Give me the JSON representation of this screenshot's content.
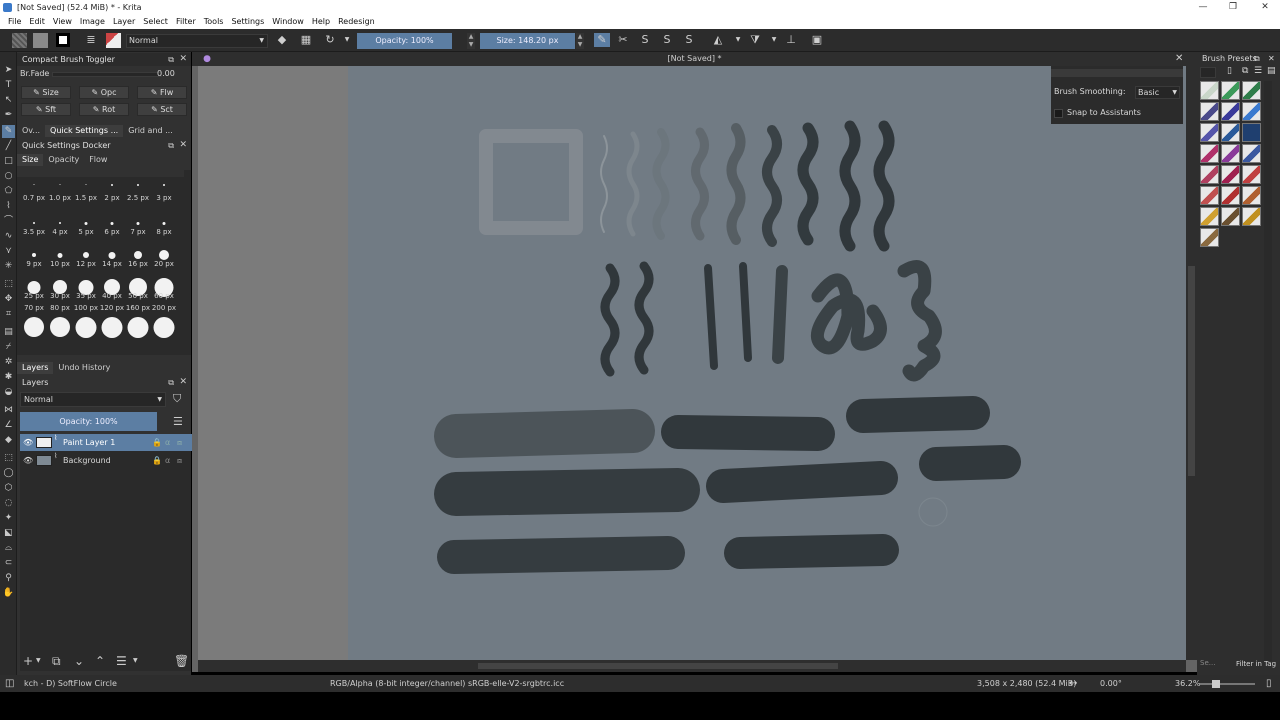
{
  "window": {
    "title": "[Not Saved]  (52.4 MiB)  * - Krita",
    "minimize": "—",
    "maximize": "❐",
    "close": "✕"
  },
  "menu": [
    "File",
    "Edit",
    "View",
    "Image",
    "Layer",
    "Select",
    "Filter",
    "Tools",
    "Settings",
    "Window",
    "Help",
    "Redesign"
  ],
  "toolbar": {
    "blend_mode": "Normal",
    "opacity_label": "Opacity: 100%",
    "size_label": "Size: 148.20 px"
  },
  "compact_toggler": {
    "title": "Compact Brush Toggler",
    "brfade_label": "Br.Fade",
    "brfade_value": "0.00",
    "buttons": [
      "Size",
      "Opc",
      "Flw",
      "Sft",
      "Rot",
      "Sct"
    ]
  },
  "docker_tabs": [
    "Ov...",
    "Quick Settings ...",
    "Grid and ..."
  ],
  "quick_settings": {
    "title": "Quick Settings Docker",
    "tabs": [
      "Size",
      "Opacity",
      "Flow"
    ],
    "sizes": [
      "0.7 px",
      "1.0 px",
      "1.5 px",
      "2 px",
      "2.5 px",
      "3 px",
      "3.5 px",
      "4 px",
      "5 px",
      "6 px",
      "7 px",
      "8 px",
      "9 px",
      "10 px",
      "12 px",
      "14 px",
      "16 px",
      "20 px",
      "25 px",
      "30 px",
      "35 px",
      "40 px",
      "50 px",
      "60 px",
      "70 px",
      "80 px",
      "100 px",
      "120 px",
      "160 px",
      "200 px"
    ]
  },
  "layers_tabs": [
    "Layers",
    "Undo History"
  ],
  "layers": {
    "title": "Layers",
    "blend_mode": "Normal",
    "opacity_label": "Opacity:  100%",
    "items": [
      {
        "name": "Paint Layer 1",
        "selected": true
      },
      {
        "name": "Background",
        "selected": false
      }
    ]
  },
  "canvas": {
    "doc_title": "[Not Saved]  *",
    "brush_smoothing_label": "Brush Smoothing:",
    "brush_smoothing_value": "Basic",
    "snap_label": "Snap to Assistants"
  },
  "presets": {
    "title": "Brush Presets",
    "tag_filter": "Filter in Tag",
    "search_placeholder": "Se..."
  },
  "status": {
    "brush": "kch - D) SoftFlow Circle",
    "colorspace": "RGB/Alpha (8-bit integer/channel)  sRGB-elle-V2-srgbtrc.icc",
    "dimensions": "3,508 x 2,480 (52.4 MiB)",
    "rotation": "0.00°",
    "zoom": "36.2%"
  },
  "colors": {
    "accent": "#5c7ea3",
    "paper": "#717b84",
    "stroke": "#2f3538"
  }
}
